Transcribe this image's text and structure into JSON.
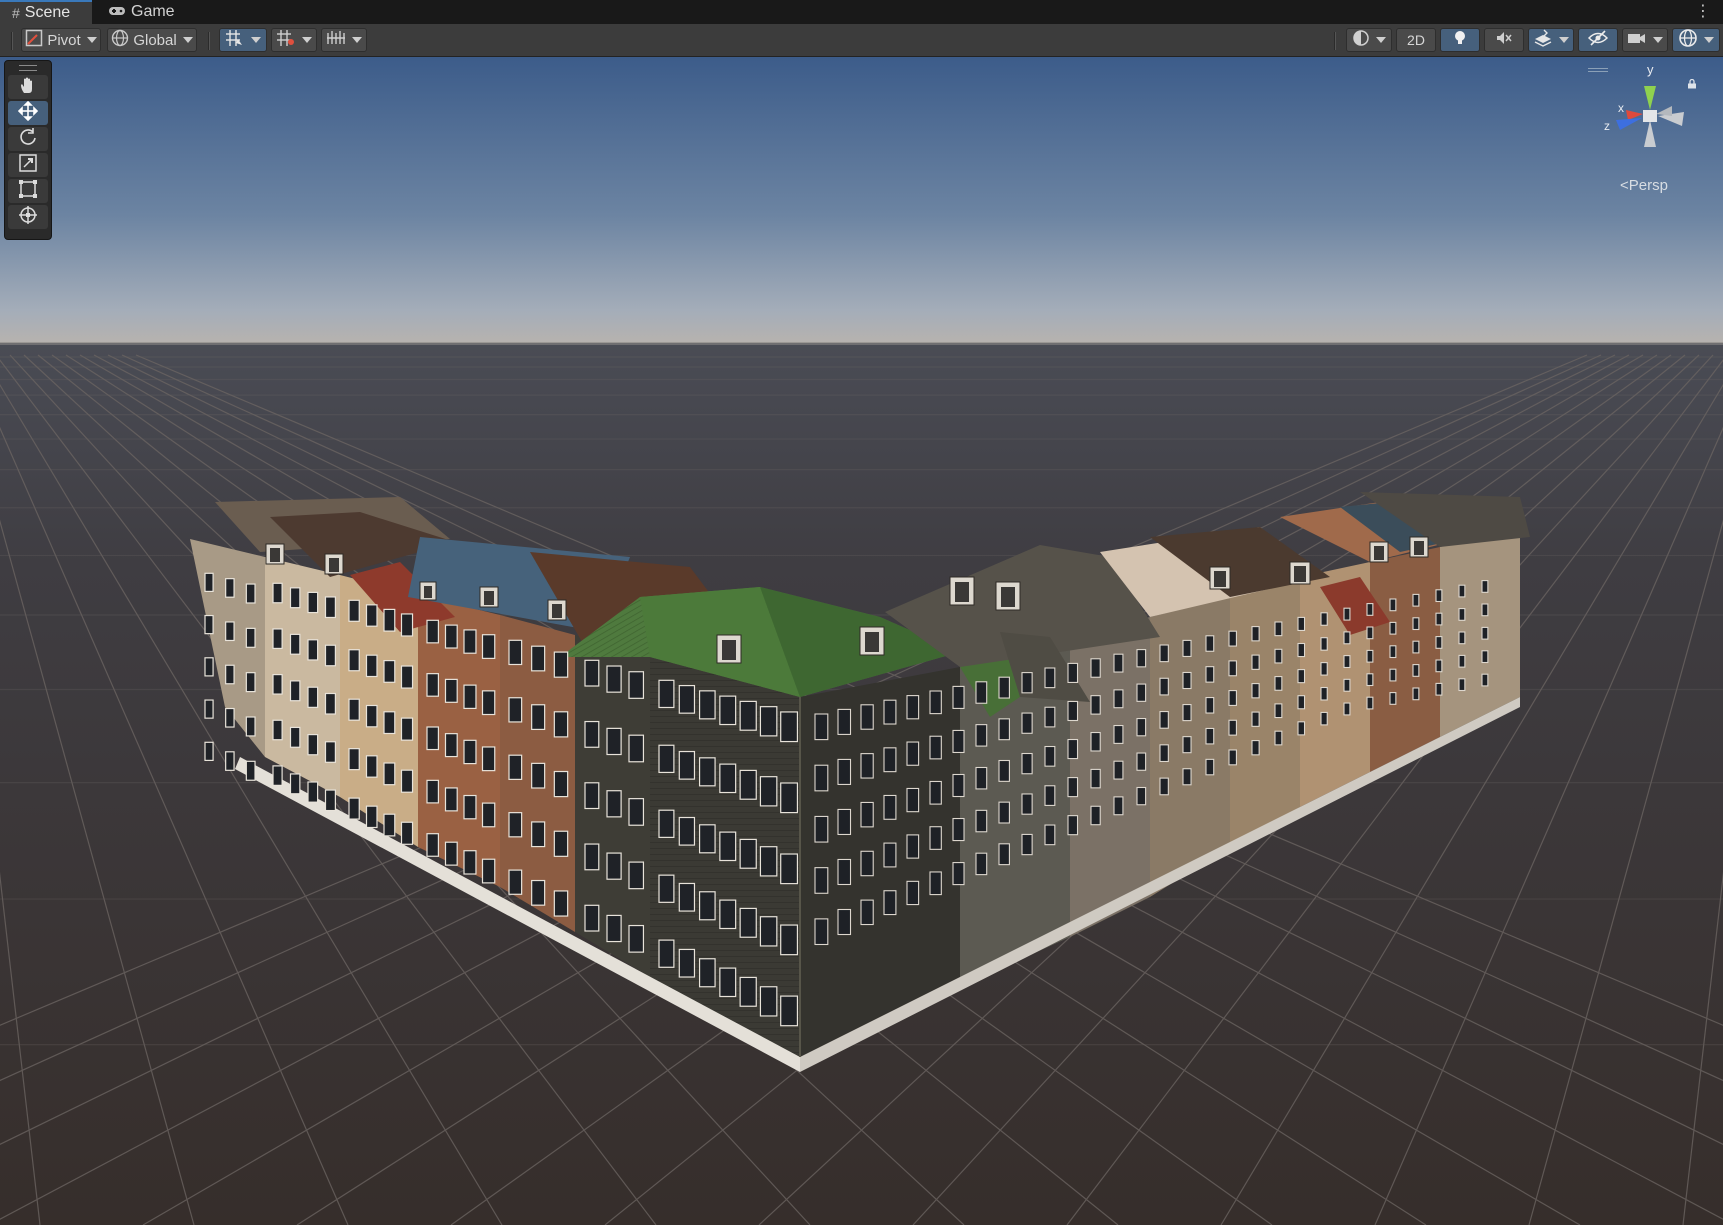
{
  "tabs": [
    {
      "label": "Scene",
      "icon": "grid-hash-icon",
      "active": true
    },
    {
      "label": "Game",
      "icon": "gamepad-icon",
      "active": false
    }
  ],
  "toolbar": {
    "pivot_label": "Pivot",
    "global_label": "Global",
    "mode_2d_label": "2D",
    "left_buttons": [
      "pivot-dropdown",
      "global-dropdown",
      "grid-snap",
      "increment-snap",
      "grid-visibility"
    ],
    "right_buttons": [
      "draw-mode-dropdown",
      "2d-toggle",
      "lighting-toggle",
      "audio-toggle",
      "effects-dropdown",
      "scene-visibility-toggle",
      "camera-settings-dropdown",
      "gizmos-dropdown"
    ]
  },
  "tools": [
    {
      "name": "hand-tool",
      "icon": "hand-icon",
      "active": false
    },
    {
      "name": "move-tool",
      "icon": "move-arrows-icon",
      "active": true
    },
    {
      "name": "rotate-tool",
      "icon": "rotate-icon",
      "active": false
    },
    {
      "name": "scale-tool",
      "icon": "scale-icon",
      "active": false
    },
    {
      "name": "rect-tool",
      "icon": "rect-transform-icon",
      "active": false
    },
    {
      "name": "transform-tool",
      "icon": "transform-icon",
      "active": false
    }
  ],
  "gizmo": {
    "axis_y": "y",
    "axis_x": "x",
    "axis_z": "z",
    "projection_label": "Persp"
  },
  "colors": {
    "accent": "#3a79bb",
    "active_button": "#46607c",
    "toolbar_bg": "#3c3c3c",
    "sky_top": "#3d5f8c",
    "sky_horizon": "#aab0b8",
    "ground": "#3a3432",
    "gizmo_y": "#8fd14f",
    "gizmo_x": "#e04a3c",
    "gizmo_z": "#3d6fe0"
  }
}
